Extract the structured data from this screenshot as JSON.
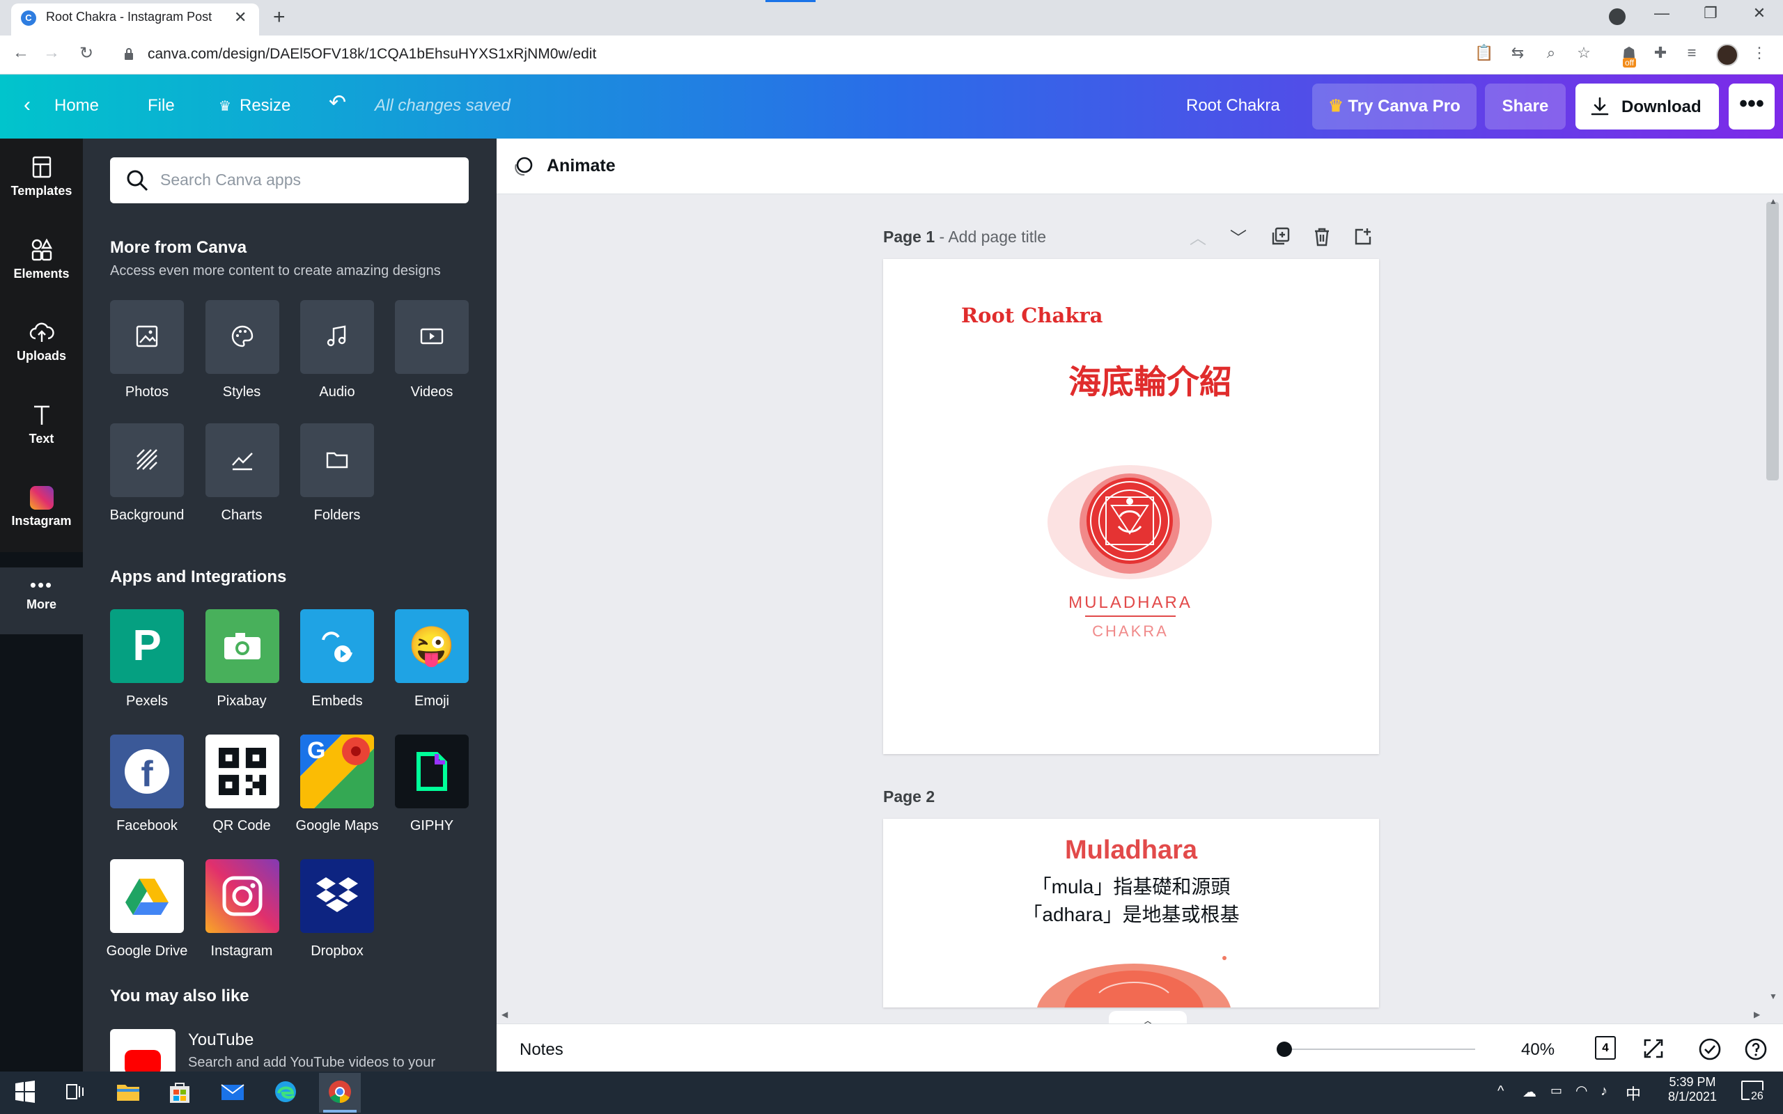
{
  "browser": {
    "tab_title": "Root Chakra - Instagram Post",
    "tab_favicon": "C",
    "url": "canva.com/design/DAEl5OFV18k/1CQA1bEhsuHYXS1xRjNM0w/edit",
    "ext_badge": "off"
  },
  "header": {
    "home": "Home",
    "file": "File",
    "resize": "Resize",
    "save_status": "All changes saved",
    "design_title": "Root Chakra",
    "try_pro": "Try Canva Pro",
    "share": "Share",
    "download": "Download"
  },
  "rail": {
    "items": [
      {
        "label": "Templates",
        "icon": "templates-icon"
      },
      {
        "label": "Elements",
        "icon": "elements-icon"
      },
      {
        "label": "Uploads",
        "icon": "uploads-icon"
      },
      {
        "label": "Text",
        "icon": "text-icon"
      },
      {
        "label": "Instagram",
        "icon": "instagram-icon"
      },
      {
        "label": "More",
        "icon": "more-dots-icon"
      }
    ]
  },
  "panel": {
    "search_placeholder": "Search Canva apps",
    "more_title": "More from Canva",
    "more_sub": "Access even more content to create amazing designs",
    "more_items": [
      "Photos",
      "Styles",
      "Audio",
      "Videos",
      "Background",
      "Charts",
      "Folders"
    ],
    "apps_title": "Apps and Integrations",
    "apps": [
      "Pexels",
      "Pixabay",
      "Embeds",
      "Emoji",
      "Facebook",
      "QR Code",
      "Google Maps",
      "GIPHY",
      "Google Drive",
      "Instagram",
      "Dropbox"
    ],
    "also_title": "You may also like",
    "also_item_title": "YouTube",
    "also_item_desc": "Search and add YouTube videos to your"
  },
  "workspace": {
    "animate": "Animate",
    "page1_label": "Page 1",
    "page1_title_ph": "- Add page title",
    "page1_heading": "Root Chakra",
    "page1_chinese": "海底輪介紹",
    "logo_top": "MULADHARA",
    "logo_bottom": "CHAKRA",
    "page2_label": "Page 2",
    "page2_heading": "Muladhara",
    "page2_line1": "「mula」指基礎和源頭",
    "page2_line2": "「adhara」是地基或根基",
    "notes": "Notes",
    "zoom": "40%",
    "page_count": "4",
    "zoom_fraction": 0.02
  },
  "taskbar": {
    "time": "5:39 PM",
    "date": "8/1/2021",
    "ime": "中",
    "notif_count": "26"
  },
  "colors": {
    "accent_red": "#e02c2c",
    "canva_purple": "#7d2ae8",
    "canva_teal": "#01c4cc"
  }
}
